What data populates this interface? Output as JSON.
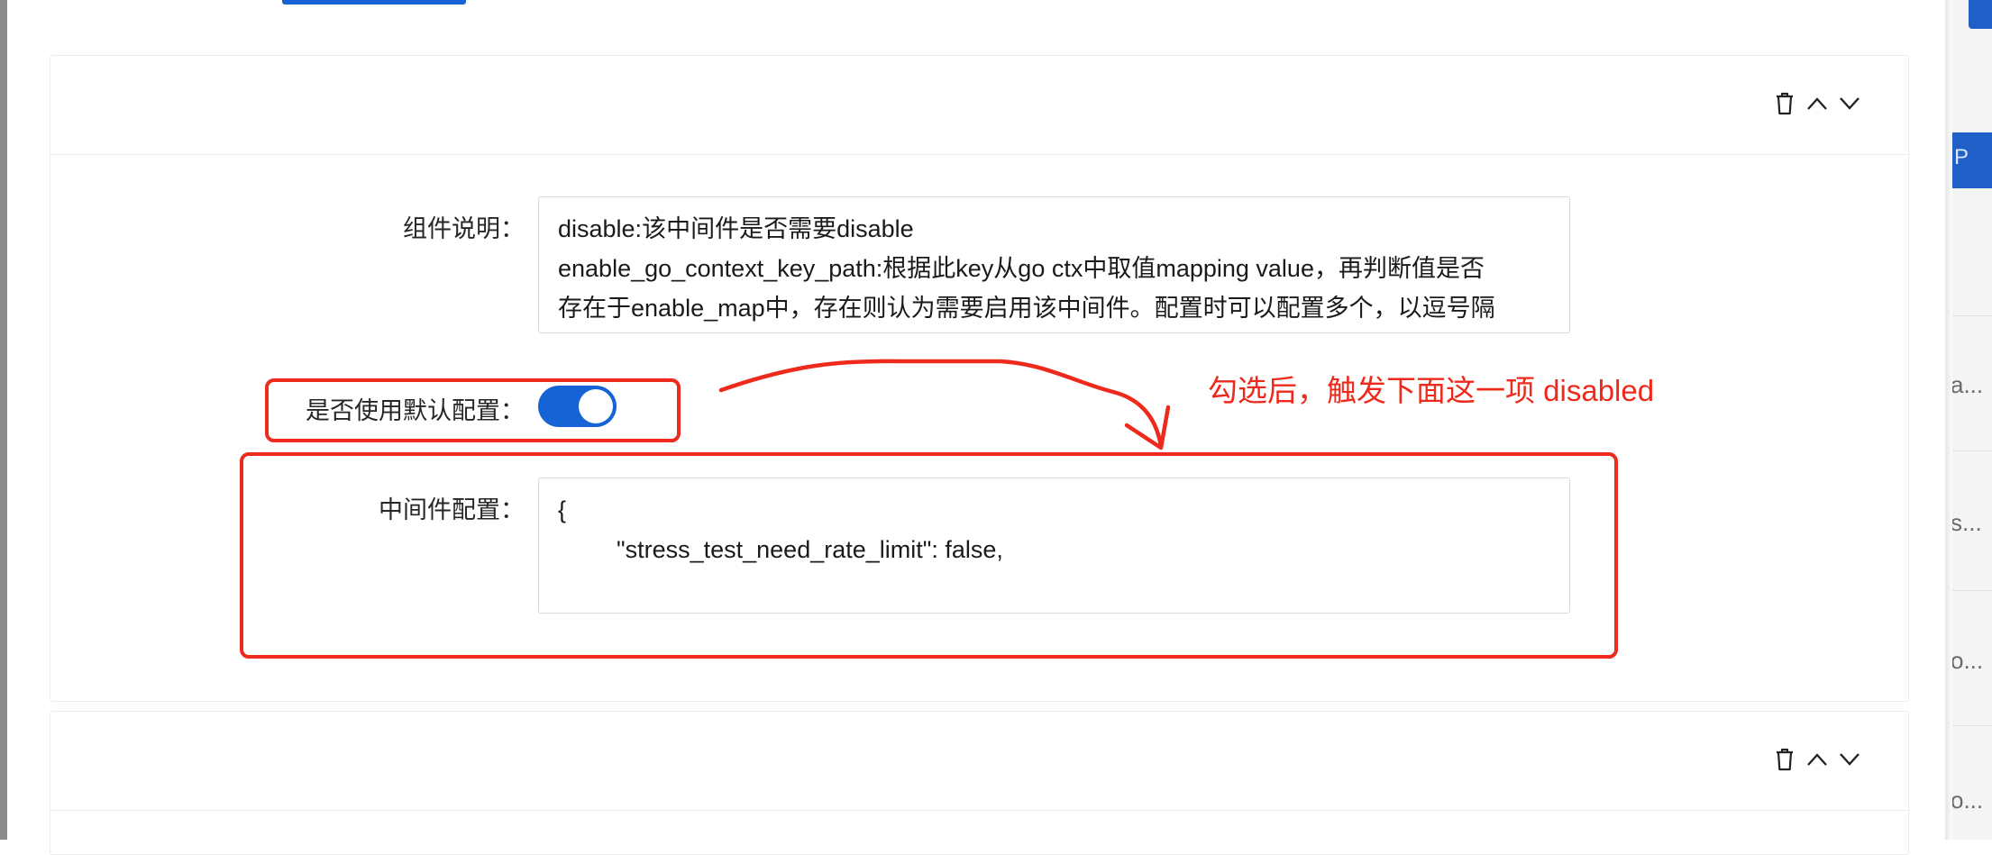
{
  "form": {
    "description_label": "组件说明：",
    "description_lines": [
      "disable:该中间件是否需要disable",
      "enable_go_context_key_path:根据此key从go ctx中取值mapping value，再判断值是否",
      "存在于enable_map中，存在则认为需要启用该中间件。配置时可以配置多个，以逗号隔"
    ],
    "use_default_label": "是否使用默认配置：",
    "use_default_enabled": true,
    "middleware_config_label": "中间件配置：",
    "middleware_config_lines": [
      "{",
      "\"stress_test_need_rate_limit\": false,"
    ]
  },
  "annotation": {
    "text": "勾选后，触发下面这一项 disabled",
    "color": "#ee2a1c"
  },
  "background_list": {
    "button_label": "P",
    "row_texts": [
      "a...",
      "s...",
      "o...",
      "o..."
    ]
  },
  "colors": {
    "primary": "#1663d6",
    "annotation": "#ee2a1c",
    "border": "#d9d9d9"
  },
  "icons": [
    "delete-icon",
    "chevron-up-icon",
    "chevron-down-icon"
  ]
}
